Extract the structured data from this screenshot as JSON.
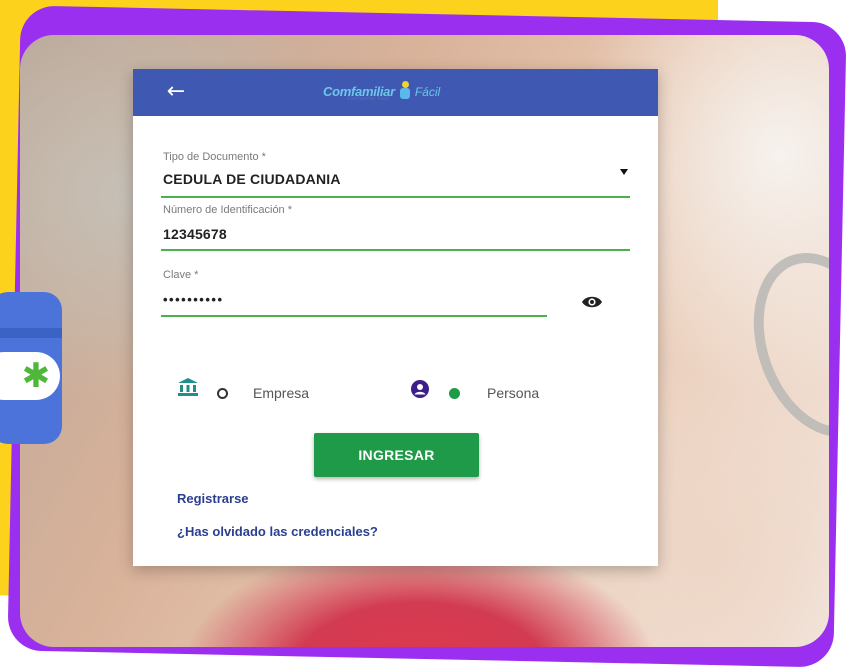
{
  "header": {
    "back_icon": "arrow-left-icon",
    "logo": {
      "brand": "Comfamiliar",
      "suffix": "Fácil",
      "tagline": "Comfamiliar Fácil"
    }
  },
  "form": {
    "document_type": {
      "label": "Tipo de Documento *",
      "value": "CEDULA DE CIUDADANIA"
    },
    "id_number": {
      "label": "Número de Identificación *",
      "value": "12345678"
    },
    "password": {
      "label": "Clave *",
      "value": "••••••••••",
      "toggle_icon": "eye-icon"
    }
  },
  "user_type": {
    "options": [
      {
        "label": "Empresa",
        "icon": "bank-icon",
        "selected": false
      },
      {
        "label": "Persona",
        "icon": "person-icon",
        "selected": true
      }
    ]
  },
  "actions": {
    "submit_label": "INGRESAR",
    "register_label": "Registrarse",
    "forgot_label": "¿Has olvidado las credenciales?"
  },
  "colors": {
    "header": "#3f59b3",
    "accent_green": "#1f9a49",
    "field_underline": "#4caf50",
    "link": "#2b3f92",
    "background_yellow": "#fdd21c",
    "background_purple": "#9b2ff0"
  }
}
